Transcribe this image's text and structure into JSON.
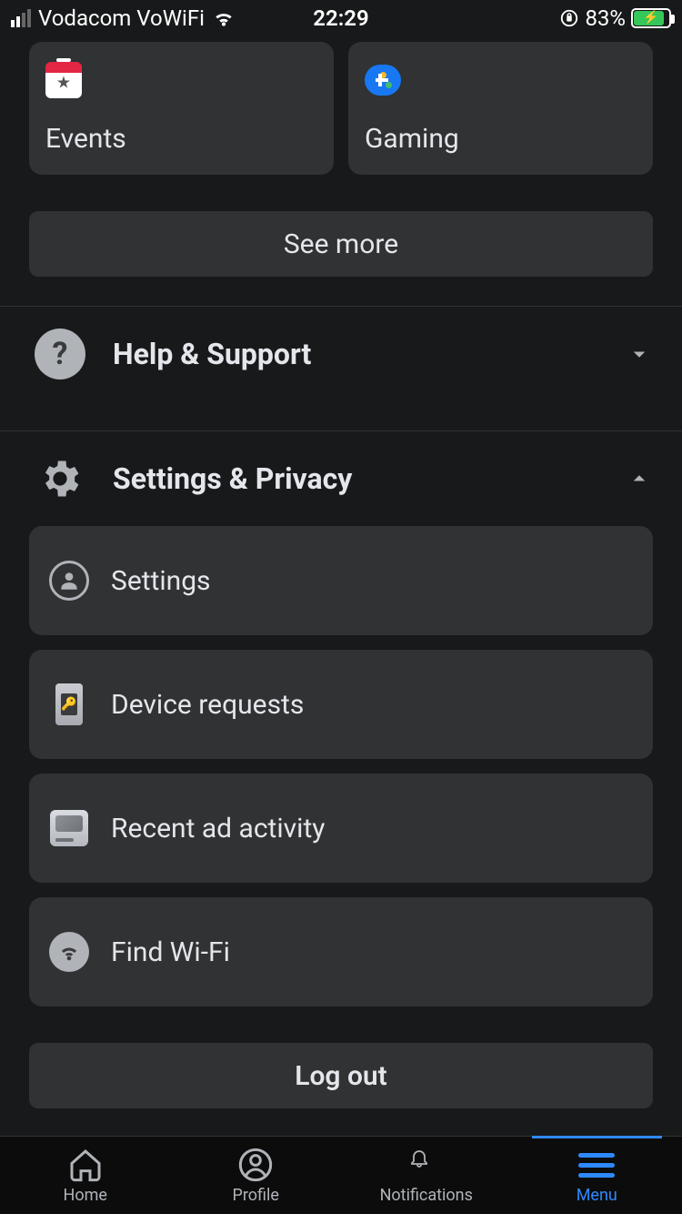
{
  "status_bar": {
    "carrier": "Vodacom VoWiFi",
    "time": "22:29",
    "battery_pct": "83%"
  },
  "shortcuts": [
    {
      "label": "Events",
      "icon": "events-icon"
    },
    {
      "label": "Gaming",
      "icon": "gaming-icon"
    }
  ],
  "see_more_label": "See more",
  "sections": {
    "help": {
      "title": "Help & Support",
      "expanded": false
    },
    "settings_privacy": {
      "title": "Settings & Privacy",
      "expanded": true,
      "items": [
        {
          "label": "Settings",
          "icon": "person-icon"
        },
        {
          "label": "Device requests",
          "icon": "device-icon"
        },
        {
          "label": "Recent ad activity",
          "icon": "ad-icon"
        },
        {
          "label": "Find Wi-Fi",
          "icon": "wifi-icon"
        }
      ]
    }
  },
  "logout_label": "Log out",
  "tabs": [
    {
      "label": "Home",
      "icon": "home-icon",
      "active": false
    },
    {
      "label": "Profile",
      "icon": "profile-icon",
      "active": false
    },
    {
      "label": "Notifications",
      "icon": "bell-icon",
      "active": false
    },
    {
      "label": "Menu",
      "icon": "hamburger-icon",
      "active": true
    }
  ]
}
